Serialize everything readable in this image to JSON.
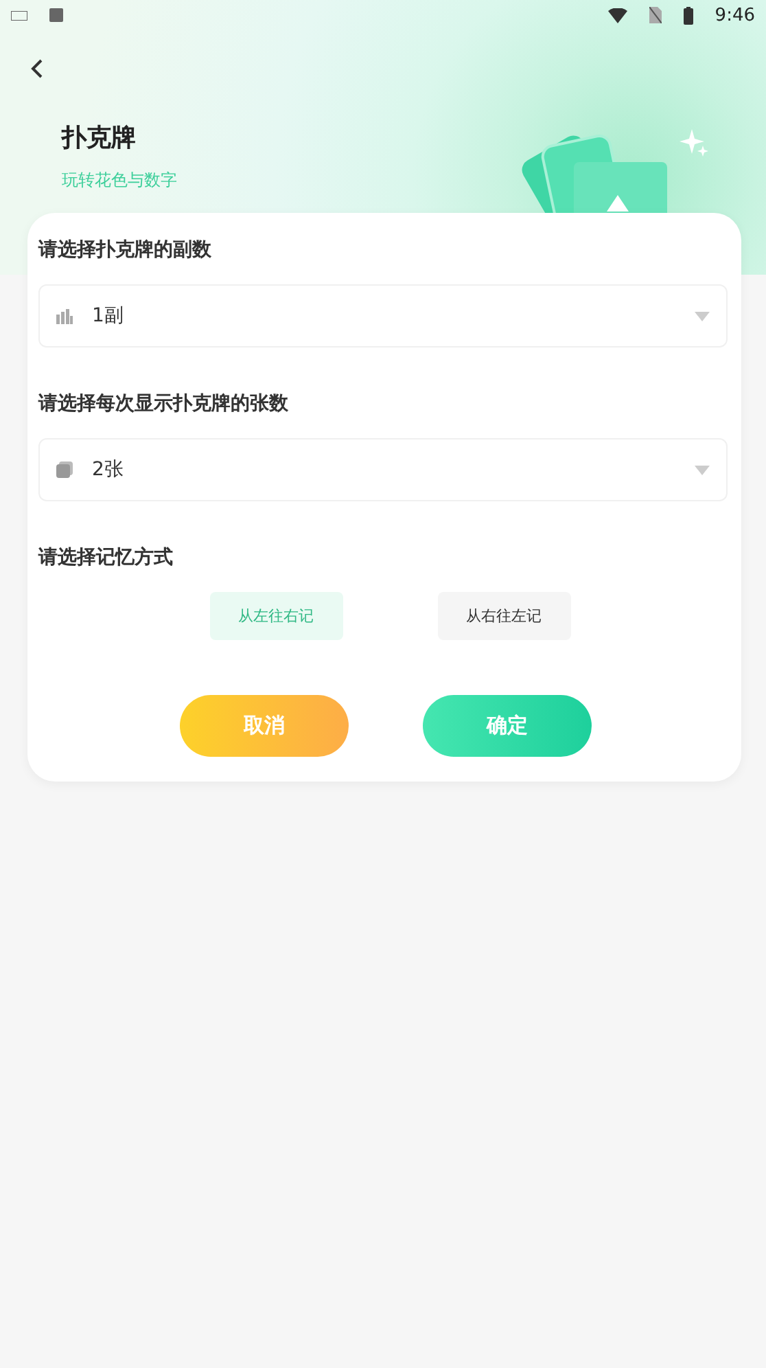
{
  "status_bar": {
    "time": "9:46"
  },
  "header": {
    "title": "扑克牌",
    "subtitle": "玩转花色与数字"
  },
  "sections": [
    {
      "kind": "select",
      "label": "请选择扑克牌的副数",
      "value": "1副"
    },
    {
      "kind": "select",
      "label": "请选择每次显示扑克牌的张数",
      "value": "2张"
    },
    {
      "kind": "options",
      "label": "请选择记忆方式",
      "options": [
        {
          "label": "从左往右记",
          "selected": true
        },
        {
          "label": "从右往左记",
          "selected": false
        }
      ]
    }
  ],
  "buttons": [
    {
      "label": "取消",
      "kind": "cancel"
    },
    {
      "label": "确定",
      "kind": "confirm"
    }
  ]
}
